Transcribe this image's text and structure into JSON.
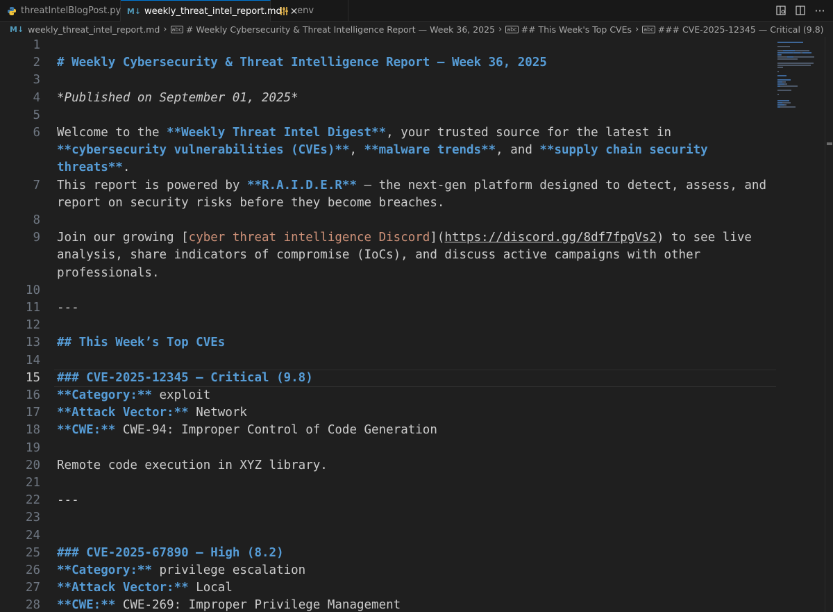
{
  "tabs": [
    {
      "label": "threatIntelBlogPost.py",
      "icon": "python-icon"
    },
    {
      "label": "weekly_threat_intel_report.md",
      "icon": "markdown-icon",
      "active": true
    },
    {
      "label": ".env",
      "icon": "env-settings-icon"
    }
  ],
  "breadcrumb": {
    "file": "weekly_threat_intel_report.md",
    "h1": "# Weekly Cybersecurity & Threat Intelligence Report — Week 36, 2025",
    "h2": "## This Week's Top CVEs",
    "h3": "### CVE-2025-12345 — Critical (9.8)"
  },
  "editor": {
    "current_line": 15,
    "lines": [
      {
        "n": "1",
        "parts": []
      },
      {
        "n": "2",
        "parts": [
          {
            "t": "# Weekly Cybersecurity & Threat Intelligence Report — Week 36, 2025",
            "c": "h"
          }
        ]
      },
      {
        "n": "3",
        "parts": []
      },
      {
        "n": "4",
        "parts": [
          {
            "t": "*Published on September 01, 2025*",
            "c": "it"
          }
        ]
      },
      {
        "n": "5",
        "parts": []
      },
      {
        "n": "6",
        "parts": [
          {
            "t": "Welcome to the ",
            "c": ""
          },
          {
            "t": "**Weekly Threat Intel Digest**",
            "c": "b"
          },
          {
            "t": ", your trusted source for the latest in",
            "c": ""
          }
        ]
      },
      {
        "n": "",
        "parts": [
          {
            "t": "**cybersecurity vulnerabilities (CVEs)**",
            "c": "b"
          },
          {
            "t": ", ",
            "c": ""
          },
          {
            "t": "**malware trends**",
            "c": "b"
          },
          {
            "t": ", and ",
            "c": ""
          },
          {
            "t": "**supply chain security",
            "c": "b"
          }
        ]
      },
      {
        "n": "",
        "parts": [
          {
            "t": "threats**",
            "c": "b"
          },
          {
            "t": ".",
            "c": ""
          }
        ]
      },
      {
        "n": "7",
        "parts": [
          {
            "t": "This report is powered by ",
            "c": ""
          },
          {
            "t": "**R.A.I.D.E.R**",
            "c": "b"
          },
          {
            "t": " — the next-gen platform designed to detect, assess, and",
            "c": ""
          }
        ]
      },
      {
        "n": "",
        "parts": [
          {
            "t": "report on security risks before they become breaches.",
            "c": ""
          }
        ]
      },
      {
        "n": "8",
        "parts": []
      },
      {
        "n": "9",
        "parts": [
          {
            "t": "Join our growing [",
            "c": ""
          },
          {
            "t": "cyber threat intelligence Discord",
            "c": "lt"
          },
          {
            "t": "](",
            "c": ""
          },
          {
            "t": "https://discord.gg/8df7fpgVs2",
            "c": "url"
          },
          {
            "t": ") to see live",
            "c": ""
          }
        ]
      },
      {
        "n": "",
        "parts": [
          {
            "t": "analysis, share indicators of compromise (IoCs), and discuss active campaigns with other",
            "c": ""
          }
        ]
      },
      {
        "n": "",
        "parts": [
          {
            "t": "professionals.",
            "c": ""
          }
        ]
      },
      {
        "n": "10",
        "parts": []
      },
      {
        "n": "11",
        "parts": [
          {
            "t": "---",
            "c": ""
          }
        ]
      },
      {
        "n": "12",
        "parts": []
      },
      {
        "n": "13",
        "parts": [
          {
            "t": "## This Week’s Top CVEs",
            "c": "h"
          }
        ]
      },
      {
        "n": "14",
        "parts": []
      },
      {
        "n": "15",
        "parts": [
          {
            "t": "### CVE-2025-12345 — Critical (9.8)",
            "c": "h"
          }
        ]
      },
      {
        "n": "16",
        "parts": [
          {
            "t": "**Category:**",
            "c": "b"
          },
          {
            "t": " exploit",
            "c": ""
          }
        ]
      },
      {
        "n": "17",
        "parts": [
          {
            "t": "**Attack Vector:**",
            "c": "b"
          },
          {
            "t": " Network",
            "c": ""
          }
        ]
      },
      {
        "n": "18",
        "parts": [
          {
            "t": "**CWE:**",
            "c": "b"
          },
          {
            "t": " CWE-94: Improper Control of Code Generation",
            "c": ""
          }
        ]
      },
      {
        "n": "19",
        "parts": []
      },
      {
        "n": "20",
        "parts": [
          {
            "t": "Remote code execution in XYZ library.",
            "c": ""
          }
        ]
      },
      {
        "n": "21",
        "parts": []
      },
      {
        "n": "22",
        "parts": [
          {
            "t": "---",
            "c": ""
          }
        ]
      },
      {
        "n": "23",
        "parts": []
      },
      {
        "n": "24",
        "parts": []
      },
      {
        "n": "25",
        "parts": [
          {
            "t": "### CVE-2025-67890 — High (8.2)",
            "c": "h"
          }
        ]
      },
      {
        "n": "26",
        "parts": [
          {
            "t": "**Category:**",
            "c": "b"
          },
          {
            "t": " privilege escalation",
            "c": ""
          }
        ]
      },
      {
        "n": "27",
        "parts": [
          {
            "t": "**Attack Vector:**",
            "c": "b"
          },
          {
            "t": " Local",
            "c": ""
          }
        ]
      },
      {
        "n": "28",
        "parts": [
          {
            "t": "**CWE:**",
            "c": "b"
          },
          {
            "t": " CWE-269: Improper Privilege Management",
            "c": ""
          }
        ]
      }
    ]
  },
  "colors": {
    "heading": "#569cd6",
    "link_text": "#ce9178",
    "text": "#cccccc",
    "line_number": "#6e7681"
  }
}
